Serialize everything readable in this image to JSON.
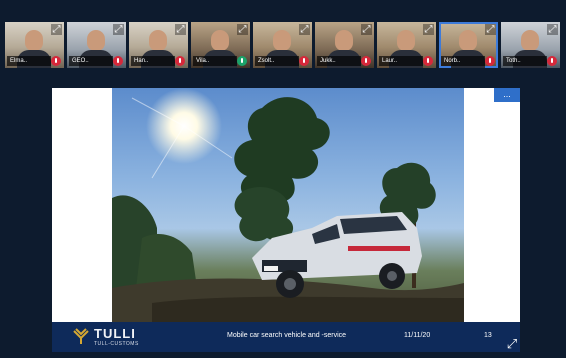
{
  "participants": [
    {
      "name": "Elma..",
      "mic": "muted",
      "active": false
    },
    {
      "name": "GEO..",
      "mic": "muted",
      "active": false
    },
    {
      "name": "Han..",
      "mic": "muted",
      "active": false
    },
    {
      "name": "Vila..",
      "mic": "on",
      "active": false
    },
    {
      "name": "Zsolt..",
      "mic": "muted",
      "active": false
    },
    {
      "name": "Jukk..",
      "mic": "muted",
      "active": false
    },
    {
      "name": "Laur..",
      "mic": "muted",
      "active": false
    },
    {
      "name": "Norb..",
      "mic": "muted",
      "active": true
    },
    {
      "name": "Toth..",
      "mic": "muted",
      "active": false
    }
  ],
  "slide": {
    "menu_label": "...",
    "logo_name": "TULLI",
    "logo_subtitle": "TULL-CUSTOMS",
    "title": "Mobile car search vehicle and -service",
    "date": "11/11/20",
    "page": "13"
  },
  "colors": {
    "app_background": "#0d1b2e",
    "slide_footer": "#0e2a5a",
    "active_outline": "#3d7bd9",
    "mic_muted": "#d6283a",
    "mic_on": "#1ba36a"
  },
  "icons": {
    "tile_expand": "expand-icon",
    "mic": "microphone-icon",
    "fullscreen": "fullscreen-icon"
  }
}
